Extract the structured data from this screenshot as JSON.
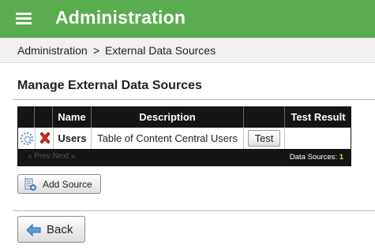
{
  "header": {
    "title": "Administration",
    "background_color": "#5aad4e"
  },
  "breadcrumb": {
    "items": [
      "Administration",
      "External Data Sources"
    ],
    "separator": ">"
  },
  "section": {
    "title": "Manage External Data Sources"
  },
  "grid": {
    "columns": [
      "",
      "",
      "Name",
      "Description",
      "",
      "Test Result"
    ],
    "rows": [
      {
        "settings_icon": "gear-icon",
        "delete_icon": "delete-x-icon",
        "name": "Users",
        "description": "Table of Content Central Users",
        "test_button": "Test",
        "test_result": ""
      }
    ],
    "pager": "« Prev Next »",
    "footer_label": "Data Sources:",
    "footer_count": "1"
  },
  "actions": {
    "add_source_label": "Add Source",
    "add_source_icon": "add-data-source-icon",
    "back_label": "Back",
    "back_icon": "back-arrow-icon"
  }
}
